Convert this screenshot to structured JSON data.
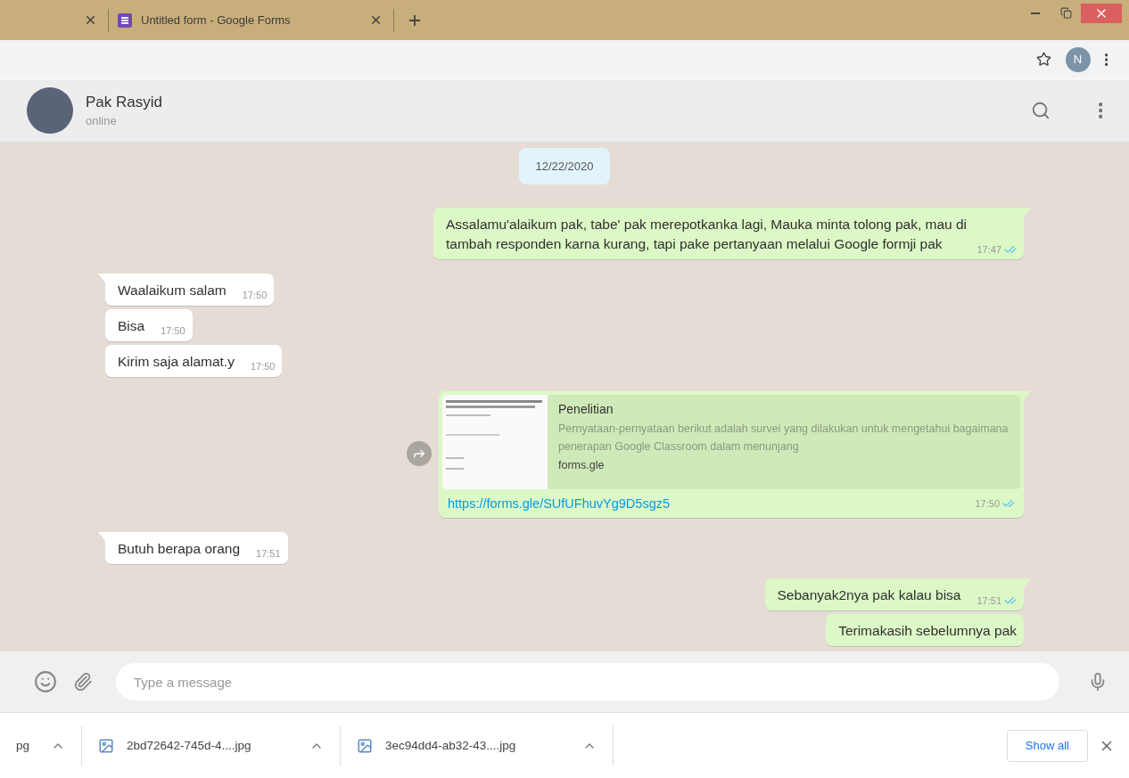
{
  "browser": {
    "tabs": [
      {
        "kind": "cut"
      },
      {
        "kind": "forms",
        "title": "Untitled form - Google Forms"
      }
    ],
    "profile_initial": "N"
  },
  "chat": {
    "contact_name": "Pak Rasyid",
    "contact_status": "online",
    "messages": [
      {
        "kind": "date",
        "text": "12/22/2020"
      },
      {
        "kind": "out",
        "text": "Assalamu'alaikum pak, tabe' pak merepotkanka lagi, Mauka minta tolong pak, mau di tambah responden karna kurang, tapi pake pertanyaan melalui Google formji pak",
        "time": "17:47",
        "read": true,
        "tail": true
      },
      {
        "kind": "in",
        "text": "Waalaikum salam",
        "time": "17:50",
        "tail": true
      },
      {
        "kind": "in",
        "text": "Bisa",
        "time": "17:50",
        "tail": false
      },
      {
        "kind": "in",
        "text": "Kirim saja alamat.y",
        "time": "17:50",
        "tail": false
      },
      {
        "kind": "link",
        "title": "Penelitian",
        "description": "Pernyataan-pernyataan berikut adalah survei yang dilakukan untuk mengetahui bagaimana penerapan Google Classroom dalam menunjang",
        "domain": "forms.gle",
        "url": "https://forms.gle/SUfUFhuvYg9D5sgz5",
        "time": "17:50",
        "read": true
      },
      {
        "kind": "in",
        "text": "Butuh berapa orang",
        "time": "17:51",
        "tail": true
      },
      {
        "kind": "out",
        "text": "Sebanyak2nya pak kalau bisa",
        "time": "17:51",
        "read": true,
        "tail": true
      },
      {
        "kind": "out",
        "text": "Terimakasih sebelumnya pak",
        "tail": false
      }
    ],
    "composer": {
      "placeholder": "Type a message"
    }
  },
  "downloads": {
    "items": [
      {
        "kind": "cut",
        "name": "pg"
      },
      {
        "kind": "image",
        "name": "2bd72642-745d-4....jpg"
      },
      {
        "kind": "image",
        "name": "3ec94dd4-ab32-43....jpg"
      }
    ],
    "show_all": "Show all"
  }
}
